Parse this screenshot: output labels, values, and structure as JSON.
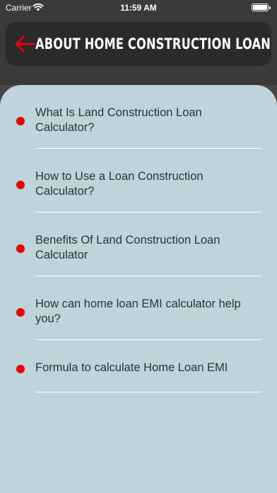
{
  "status_bar": {
    "carrier": "Carrier",
    "time": "11:59 AM"
  },
  "header": {
    "title": "ABOUT HOME CONSTRUCTION LOAN",
    "back_icon": "arrow-left-icon",
    "accent_color": "#e8000b"
  },
  "menu": {
    "items": [
      {
        "label": "What Is Land Construction Loan Calculator?"
      },
      {
        "label": "How to Use a Loan Construction Calculator?"
      },
      {
        "label": "Benefits Of Land Construction Loan Calculator"
      },
      {
        "label": "How can home loan EMI calculator help you?"
      },
      {
        "label": "Formula to calculate Home Loan EMI"
      }
    ]
  }
}
